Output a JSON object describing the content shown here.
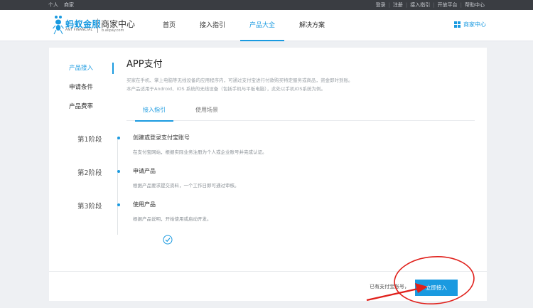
{
  "topbar": {
    "left_links": [
      "个人",
      "商家"
    ],
    "right_links": [
      "登录",
      "注册",
      "接入指引",
      "开放平台",
      "帮助中心"
    ]
  },
  "header": {
    "logo": {
      "cn": "蚂蚁金服",
      "en": "ANT FINANCIAL",
      "site_name": "商家中心",
      "site_url": "b.alipay.com"
    },
    "nav": [
      {
        "label": "首页",
        "active": false
      },
      {
        "label": "接入指引",
        "active": false
      },
      {
        "label": "产品大全",
        "active": true
      },
      {
        "label": "解决方案",
        "active": false
      }
    ],
    "merchant_link": "商家中心"
  },
  "sidebar": {
    "items": [
      {
        "label": "产品接入",
        "active": true
      },
      {
        "label": "申请条件",
        "active": false
      },
      {
        "label": "产品费率",
        "active": false
      }
    ]
  },
  "main": {
    "title": "APP支付",
    "desc_lines": [
      "买家在手机、掌上电脑等无线设备的应用程序内，可通过支付宝进行付款购买特定服务或商品，资金即时到账。",
      "本产品适用于Android、iOS 系统的无线设备（包括手机与平板电脑），此处以手机iOS系统为例。"
    ],
    "tabs": [
      {
        "label": "接入指引",
        "active": true
      },
      {
        "label": "使用场景",
        "active": false
      }
    ],
    "stages": [
      {
        "label": "第1阶段",
        "title": "创建或登录支付宝账号",
        "desc": "在支付宝网站，根据实际业务注册为个人或企业账号并完成认证。"
      },
      {
        "label": "第2阶段",
        "title": "申请产品",
        "desc": "根据产品要求提交资料，一个工作日即可通过审核。"
      },
      {
        "label": "第3阶段",
        "title": "使用产品",
        "desc": "根据产品说明，开始使用或启动开发。"
      }
    ]
  },
  "footer": {
    "text": "已有支付宝账号，",
    "button_label": "立即接入"
  },
  "colors": {
    "accent": "#1a9ae0",
    "annotation": "#e0201b",
    "topbar": "#3a3d42"
  },
  "icons": [
    "ant-logo-icon",
    "grid-icon",
    "check-circle-icon"
  ]
}
